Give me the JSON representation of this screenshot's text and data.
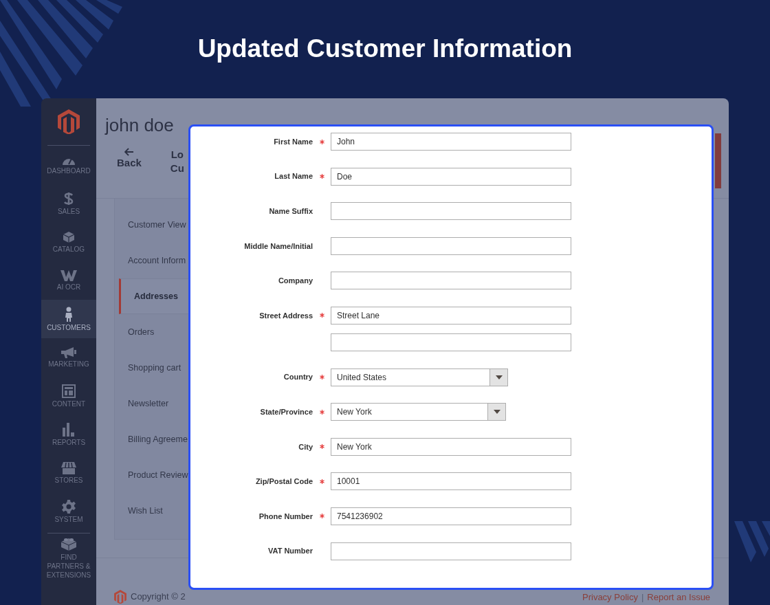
{
  "headline": "Updated Customer Information",
  "sidebar": [
    {
      "label": "DASHBOARD",
      "selected": false
    },
    {
      "label": "SALES",
      "selected": false
    },
    {
      "label": "CATALOG",
      "selected": false
    },
    {
      "label": "AI OCR",
      "selected": false
    },
    {
      "label": "CUSTOMERS",
      "selected": true
    },
    {
      "label": "MARKETING",
      "selected": false
    },
    {
      "label": "CONTENT",
      "selected": false
    },
    {
      "label": "REPORTS",
      "selected": false
    },
    {
      "label": "STORES",
      "selected": false
    },
    {
      "label": "SYSTEM",
      "selected": false
    },
    {
      "label": "FIND PARTNERS & EXTENSIONS",
      "selected": false
    }
  ],
  "page_title": "john doe",
  "toolbar": [
    {
      "kind": "back",
      "label": "Back"
    },
    {
      "kind": "text",
      "lines": [
        "Lo",
        "Cu"
      ]
    }
  ],
  "tabs": [
    {
      "label": "Customer View",
      "selected": false
    },
    {
      "label": "Account Inform",
      "selected": false
    },
    {
      "label": "Addresses",
      "selected": true
    },
    {
      "label": "Orders",
      "selected": false
    },
    {
      "label": "Shopping cart",
      "selected": false
    },
    {
      "label": "Newsletter",
      "selected": false
    },
    {
      "label": "Billing Agreeme",
      "selected": false
    },
    {
      "label": "Product Review",
      "selected": false
    },
    {
      "label": "Wish List",
      "selected": false
    }
  ],
  "footer": {
    "copyright": "Copyright © 2",
    "links": [
      "Privacy Policy",
      "Report an Issue"
    ],
    "separator": "|"
  },
  "form": [
    {
      "label": "First Name",
      "required": true,
      "kind": "text",
      "value": "John"
    },
    {
      "label": "Last Name",
      "required": true,
      "kind": "text",
      "value": "Doe"
    },
    {
      "label": "Name Suffix",
      "required": false,
      "kind": "text"
    },
    {
      "label": "Middle Name/Initial",
      "required": false,
      "kind": "text"
    },
    {
      "label": "Company",
      "required": false,
      "kind": "text"
    },
    {
      "label": "Street Address",
      "required": true,
      "kind": "street",
      "value": "Street Lane"
    },
    {
      "label": "Country",
      "required": true,
      "kind": "select",
      "value": "United States"
    },
    {
      "label": "State/Province",
      "required": true,
      "kind": "select",
      "value": "New York"
    },
    {
      "label": "City",
      "required": true,
      "kind": "text",
      "value": "New York"
    },
    {
      "label": "Zip/Postal Code",
      "required": true,
      "kind": "text",
      "value": "10001"
    },
    {
      "label": "Phone Number",
      "required": true,
      "kind": "text",
      "value": "7541236902"
    },
    {
      "label": "VAT Number",
      "required": false,
      "kind": "text"
    }
  ]
}
